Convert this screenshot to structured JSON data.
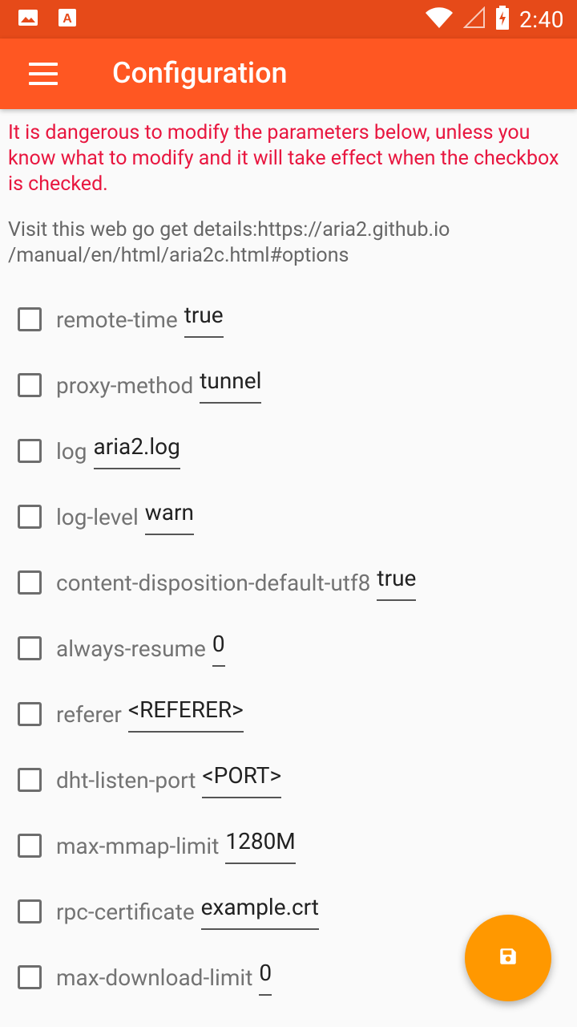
{
  "status_bar": {
    "time": "2:40",
    "left_icons": [
      "image-icon",
      "app-a-icon"
    ],
    "right_icons": [
      "wifi-icon",
      "signal-icon",
      "battery-icon"
    ]
  },
  "app_bar": {
    "title": "Configuration",
    "menu_icon": "hamburger-menu-icon",
    "color": "#ff5722"
  },
  "warning_text": "It is dangerous to modify the parameters below, unless you know what to modify and it will take effect when the checkbox is checked.",
  "info_text": "Visit this web go get details:https://aria2.github.io /manual/en/html/aria2c.html#options",
  "options": [
    {
      "name": "remote-time",
      "value": "true",
      "checked": false
    },
    {
      "name": "proxy-method",
      "value": "tunnel",
      "checked": false
    },
    {
      "name": "log",
      "value": "aria2.log",
      "checked": false
    },
    {
      "name": "log-level",
      "value": "warn",
      "checked": false
    },
    {
      "name": "content-disposition-default-utf8",
      "value": "true",
      "checked": false
    },
    {
      "name": "always-resume",
      "value": "0",
      "checked": false
    },
    {
      "name": "referer",
      "value": "<REFERER>",
      "checked": false
    },
    {
      "name": "dht-listen-port",
      "value": "<PORT>",
      "checked": false
    },
    {
      "name": "max-mmap-limit",
      "value": "1280M",
      "checked": false
    },
    {
      "name": "rpc-certificate",
      "value": "example.crt",
      "checked": false
    },
    {
      "name": "max-download-limit",
      "value": "0",
      "checked": false
    }
  ],
  "fab": {
    "icon": "save-icon",
    "color": "#ff9800"
  }
}
